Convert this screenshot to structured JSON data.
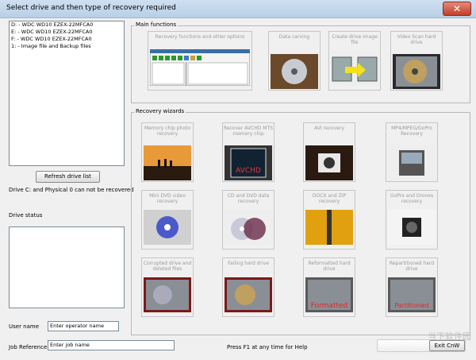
{
  "window": {
    "title": "Select drive and then type of recovery required",
    "close_glyph": "✕"
  },
  "drives": [
    "D: - WDC WD10 EZEX-22MFCA0",
    "E: - WDC WD10 EZEX-22MFCA0",
    "F: - WDC WD10 EZEX-22MFCA0",
    "1: - Image file and Backup files"
  ],
  "refresh_label": "Refresh drive list",
  "drive_note": "Drive C: and Physical 0 can not be recovered",
  "drive_status_label": "Drive status",
  "user_name_label": "User name",
  "user_name_value": "Enter operator name",
  "job_ref_label": "Job Reference",
  "job_ref_value": "Enter job name",
  "help_text": "Press F1 at any time for Help",
  "exit_label": "Exit CnW",
  "main_functions": {
    "caption": "Main functions",
    "big": "Recovery functions and other options",
    "tiles": [
      "Data carving",
      "Create drive image file",
      "Video Scan hard drive"
    ]
  },
  "wizards": {
    "caption": "Recovery wizards",
    "tiles": [
      "Memory chip photo recovery",
      "Recover AVCHD MTS memory chip",
      "AVI recovery",
      "MP4/MPEG/GoPro Recovery",
      "Mini DVD video recovery",
      "CD and DVD data recovery",
      "DOCX and ZIP recovery",
      "GoPro and Drones recovery",
      "Corrupted drive and deleted files",
      "Failing hard drive",
      "Reformatted hard drive",
      "Repartitioned hard drive"
    ]
  },
  "overlay_text": {
    "avchd": "AVCHD",
    "formatted": "Formatted",
    "partitioned": "Partitioned"
  },
  "watermark": "当下软件园"
}
